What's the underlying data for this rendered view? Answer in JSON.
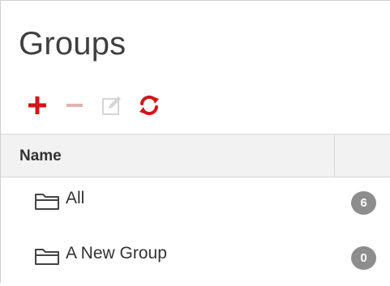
{
  "panel": {
    "title": "Groups"
  },
  "toolbar": {
    "add_icon": "plus-icon",
    "remove_icon": "minus-icon",
    "edit_icon": "edit-icon",
    "refresh_icon": "refresh-icon",
    "colors": {
      "active": "#d0161b",
      "disabled": "#e7b1b1"
    }
  },
  "table": {
    "columns": {
      "name": "Name",
      "count": ""
    },
    "rows": [
      {
        "icon": "folder-icon",
        "label": "All",
        "count": "6"
      },
      {
        "icon": "folder-icon",
        "label": "A New Group",
        "count": "0"
      }
    ]
  }
}
